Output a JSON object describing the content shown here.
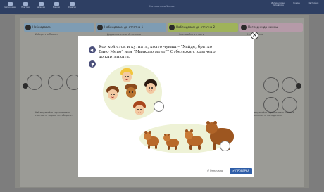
{
  "topbar": {
    "buttons": [
      "Съдържание",
      "Преглед",
      "Бележки",
      "Маркер",
      "Отметки"
    ],
    "title": "Математика 1 клас",
    "right_buttons": [
      "Интерактивна бяла дъска",
      "Помощ",
      "Настройки"
    ]
  },
  "background": {
    "tabs": [
      "Наблюдавам",
      "Наблюдавам да отгатна 1",
      "Наблюдавам да отгатна 2",
      "Погледни да кажеш"
    ],
    "subtitles": [
      "Изберете в Праказ",
      "Дидактична игра Анти мана",
      "Оценявайте в ответи",
      "Кът за оценки"
    ],
    "bottom_text_left": "Наблюдавайте картинките и съставете задача за събиране.",
    "bottom_text_right": "Наблюдавайте картинките и оценете изпълнението на задачата."
  },
  "modal": {
    "question": "Коя кой стои и кутията, която чуваш – \"Хайде, братко Вано Мецо\" или \"Малкото мече\"? Отбележи с кръгчето до картинката.",
    "reset_label": "Отначало",
    "check_label": "ПРОВЕРКА",
    "close_symbol": "×"
  },
  "colors": {
    "topbar": "#2e3f63",
    "check_button": "#2f5ea8",
    "tab_blue": "#7e9cb3",
    "tab_green": "#9fb35a",
    "tab_pink": "#b59aa8"
  }
}
